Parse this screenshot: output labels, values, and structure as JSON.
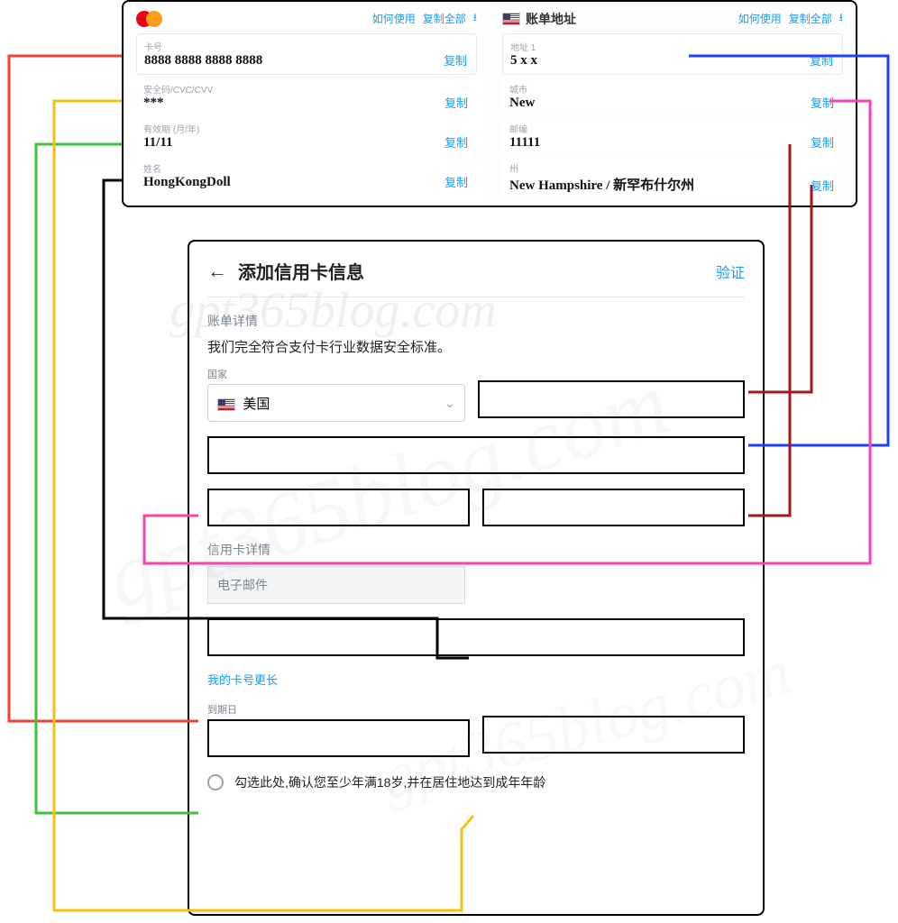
{
  "watermark": "gpt365blog.com",
  "card_panel": {
    "actions": {
      "howto": "如何使用",
      "copyall": "复制全部"
    },
    "copy_label": "复制",
    "fields": {
      "number": {
        "label": "卡号",
        "value": "8888 8888 8888 8888"
      },
      "cvv": {
        "label": "安全码/CVC/CVV",
        "value": "***"
      },
      "exp": {
        "label": "有效期 (月/年)",
        "value": "11/11"
      },
      "name": {
        "label": "姓名",
        "value": "HongKongDoll"
      }
    }
  },
  "billing_panel": {
    "title": "账单地址",
    "actions": {
      "howto": "如何使用",
      "copyall": "复制全部"
    },
    "copy_label": "复制",
    "fields": {
      "addr1": {
        "label": "地址 1",
        "value": "5 x x"
      },
      "city": {
        "label": "城市",
        "value": "New"
      },
      "zip": {
        "label": "邮编",
        "value": "11111"
      },
      "state": {
        "label": "州",
        "value": "New Hampshire / 新罕布什尔州"
      }
    }
  },
  "form": {
    "title": "添加信用卡信息",
    "verify": "验证",
    "billing_section": "账单详情",
    "compliance": "我们完全符合支付卡行业数据安全标准。",
    "country_label": "国家",
    "country_value": "美国",
    "card_section": "信用卡详情",
    "email_placeholder": "电子邮件",
    "longer_card": "我的卡号更长",
    "exp_label": "到期日",
    "confirm_text": "勾选此处,确认您至少年满18岁,并在居住地达到成年年龄"
  },
  "colors": {
    "red": "#ef4136",
    "blue": "#1f3fff",
    "darkred": "#a01818",
    "magenta": "#ff3fb4",
    "black": "#000",
    "green": "#3fc143",
    "yellow": "#f4c20d"
  }
}
